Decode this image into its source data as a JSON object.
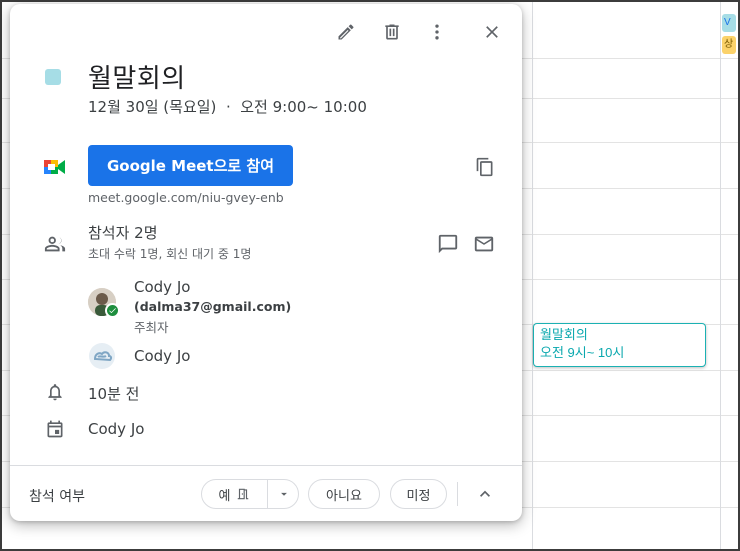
{
  "background": {
    "event_chip": {
      "title": "월말회의",
      "time": "오전 9시~ 10시"
    },
    "mini_chips": [
      "V",
      "상"
    ]
  },
  "toolbar": {
    "edit_icon": "pencil-icon",
    "delete_icon": "trash-icon",
    "more_icon": "more-vert-icon",
    "close_icon": "close-icon"
  },
  "event": {
    "color": "#a6dde6",
    "title": "월말회의",
    "datetime": "12월 30일 (목요일)  ·  오전 9:00~ 10:00"
  },
  "meet": {
    "button_label": "Google Meet으로 참여",
    "link": "meet.google.com/niu-gvey-enb"
  },
  "guests": {
    "title": "참석자 2명",
    "subtitle": "초대 수락 1명, 회신 대기 중 1명",
    "list": [
      {
        "name": "Cody Jo",
        "email": "(dalma37@gmail.com)",
        "role": "주최자"
      },
      {
        "name": "Cody Jo"
      }
    ]
  },
  "reminder": {
    "text": "10분 전"
  },
  "calendar": {
    "owner": "Cody Jo"
  },
  "rsvp": {
    "label": "참석 여부",
    "yes": "예",
    "no": "아니요",
    "maybe": "미정"
  },
  "colors": {
    "accent": "#1a73e8",
    "event_teal": "#0aa8ae",
    "accepted_green": "#1e8e3e"
  }
}
